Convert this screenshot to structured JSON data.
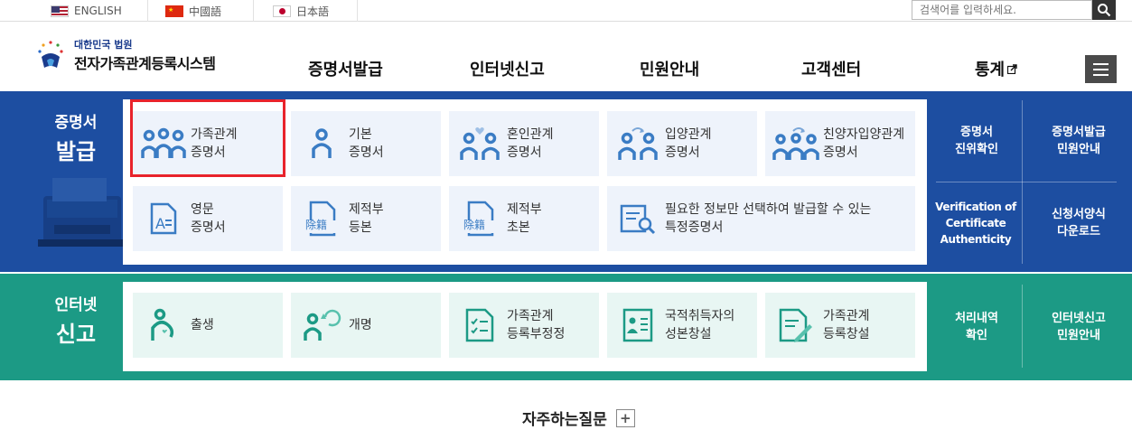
{
  "langbar": {
    "english": "ENGLISH",
    "chinese": "中國語",
    "japanese": "日本語",
    "search_placeholder": "검색어를 입력하세요."
  },
  "header": {
    "logo_small": "대한민국 법원",
    "logo_big": "전자가족관계등록시스템",
    "nav": [
      "증명서발급",
      "인터넷신고",
      "민원안내",
      "고객센터",
      "통계"
    ]
  },
  "certificate": {
    "label1": "증명서",
    "label2": "발급",
    "cards": [
      {
        "l1": "가족관계",
        "l2": "증명서"
      },
      {
        "l1": "기본",
        "l2": "증명서"
      },
      {
        "l1": "혼인관계",
        "l2": "증명서"
      },
      {
        "l1": "입양관계",
        "l2": "증명서"
      },
      {
        "l1": "친양자입양관계",
        "l2": "증명서"
      },
      {
        "l1": "영문",
        "l2": "증명서"
      },
      {
        "l1": "제적부",
        "l2": "등본"
      },
      {
        "l1": "제적부",
        "l2": "초본"
      },
      {
        "l1": "필요한 정보만 선택하여 발급할 수 있는",
        "l2": "특정증명서"
      }
    ],
    "icon_text": "除籍",
    "side": [
      {
        "l1": "증명서",
        "l2": "진위확인"
      },
      {
        "l1": "증명서발급",
        "l2": "민원안내"
      },
      {
        "l1": "Verification of",
        "l2": "Certificate",
        "l3": "Authenticity"
      },
      {
        "l1": "신청서양식",
        "l2": "다운로드"
      }
    ]
  },
  "report": {
    "label1": "인터넷",
    "label2": "신고",
    "cards": [
      {
        "l1": "출생",
        "l2": ""
      },
      {
        "l1": "개명",
        "l2": ""
      },
      {
        "l1": "가족관계",
        "l2": "등록부정정"
      },
      {
        "l1": "국적취득자의",
        "l2": "성본창설"
      },
      {
        "l1": "가족관계",
        "l2": "등록창설"
      }
    ],
    "side": [
      {
        "l1": "처리내역",
        "l2": "확인"
      },
      {
        "l1": "인터넷신고",
        "l2": "민원안내"
      }
    ]
  },
  "faq": {
    "title": "자주하는질문",
    "plus": "+"
  },
  "colors": {
    "blue": "#1d4ea1",
    "teal": "#1c9a85",
    "highlight": "#e8232b",
    "icon_blue": "#3a7cc4"
  }
}
